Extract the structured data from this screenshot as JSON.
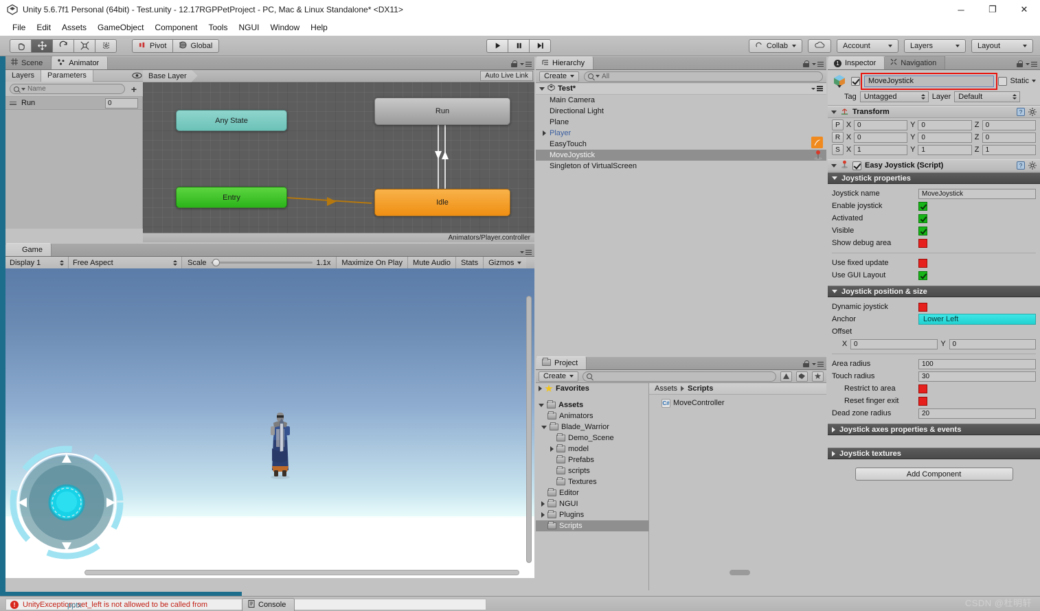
{
  "window": {
    "title": "Unity 5.6.7f1 Personal (64bit) - Test.unity - 12.17RGPPetProject - PC, Mac & Linux Standalone* <DX11>",
    "minimize": "─",
    "maximize": "❐",
    "close": "✕"
  },
  "menubar": {
    "items": [
      "File",
      "Edit",
      "Assets",
      "GameObject",
      "Component",
      "Tools",
      "NGUI",
      "Window",
      "Help"
    ]
  },
  "toolbar": {
    "tools": [
      "hand-tool",
      "move-tool",
      "rotate-tool",
      "scale-tool",
      "rect-tool"
    ],
    "active_tool_index": 1,
    "pivot_label": "Pivot",
    "global_label": "Global",
    "play_label": "Play",
    "pause_label": "Pause",
    "step_label": "Step",
    "collab_label": "Collab",
    "cloud_label": "Cloud",
    "account_label": "Account",
    "layers_label": "Layers",
    "layout_label": "Layout"
  },
  "animator": {
    "tabs": [
      {
        "label": "Scene",
        "icon": "grid-icon",
        "active": false
      },
      {
        "label": "Animator",
        "icon": "animator-icon",
        "active": true
      }
    ],
    "subtabs": [
      {
        "label": "Layers",
        "active": false
      },
      {
        "label": "Parameters",
        "active": true
      }
    ],
    "search_placeholder": "Name",
    "add_label": "+",
    "parameters": [
      {
        "name": "Run",
        "value": "0"
      }
    ],
    "layer_breadcrumb": "Base Layer",
    "auto_live_link": "Auto Live Link",
    "controller_path": "Animators/Player.controller",
    "states": [
      {
        "name": "Any State",
        "type": "any"
      },
      {
        "name": "Entry",
        "type": "entry"
      },
      {
        "name": "Run",
        "type": "state"
      },
      {
        "name": "Idle",
        "type": "default"
      }
    ]
  },
  "game": {
    "tab_label": "Game",
    "display": "Display 1",
    "aspect": "Free Aspect",
    "scale_label": "Scale",
    "scale_value": "1.1x",
    "maximize_on_play": "Maximize On Play",
    "mute_audio": "Mute Audio",
    "stats": "Stats",
    "gizmos": "Gizmos"
  },
  "hierarchy": {
    "tab_label": "Hierarchy",
    "create_label": "Create",
    "search_placeholder": "All",
    "scene_name": "Test*",
    "items": [
      {
        "label": "Main Camera",
        "expandable": false,
        "selected": false,
        "child_ref": false
      },
      {
        "label": "Directional Light",
        "expandable": false,
        "selected": false,
        "child_ref": false
      },
      {
        "label": "Plane",
        "expandable": false,
        "selected": false,
        "child_ref": false
      },
      {
        "label": "Player",
        "expandable": true,
        "selected": false,
        "child_ref": true
      },
      {
        "label": "EasyTouch",
        "expandable": false,
        "selected": false,
        "child_ref": false
      },
      {
        "label": "MoveJoystick",
        "expandable": false,
        "selected": true,
        "child_ref": false
      },
      {
        "label": "Singleton of VirtualScreen",
        "expandable": false,
        "selected": false,
        "child_ref": false
      }
    ]
  },
  "project": {
    "tab_label": "Project",
    "create_label": "Create",
    "search_placeholder": "",
    "favorites_label": "Favorites",
    "tree": [
      {
        "label": "Assets",
        "depth": 0,
        "expanded": true,
        "bold": true,
        "selected": false
      },
      {
        "label": "Animators",
        "depth": 1,
        "expanded": null,
        "bold": false,
        "selected": false
      },
      {
        "label": "Blade_Warrior",
        "depth": 1,
        "expanded": true,
        "bold": false,
        "selected": false
      },
      {
        "label": "Demo_Scene",
        "depth": 2,
        "expanded": null,
        "bold": false,
        "selected": false
      },
      {
        "label": "model",
        "depth": 2,
        "expanded": false,
        "bold": false,
        "selected": false
      },
      {
        "label": "Prefabs",
        "depth": 2,
        "expanded": null,
        "bold": false,
        "selected": false
      },
      {
        "label": "scripts",
        "depth": 2,
        "expanded": null,
        "bold": false,
        "selected": false
      },
      {
        "label": "Textures",
        "depth": 2,
        "expanded": null,
        "bold": false,
        "selected": false
      },
      {
        "label": "Editor",
        "depth": 1,
        "expanded": null,
        "bold": false,
        "selected": false
      },
      {
        "label": "NGUI",
        "depth": 1,
        "expanded": false,
        "bold": false,
        "selected": false
      },
      {
        "label": "Plugins",
        "depth": 1,
        "expanded": false,
        "bold": false,
        "selected": false
      },
      {
        "label": "Scripts",
        "depth": 1,
        "expanded": null,
        "bold": false,
        "selected": true
      }
    ],
    "breadcrumb": [
      "Assets",
      "Scripts"
    ],
    "files": [
      {
        "label": "MoveController",
        "icon": "csharp-script-icon"
      }
    ]
  },
  "inspector": {
    "tabs": [
      {
        "label": "Inspector",
        "active": true
      },
      {
        "label": "Navigation",
        "active": false
      }
    ],
    "badge": "1",
    "gameobject": {
      "name": "MoveJoystick",
      "enabled": true,
      "static_label": "Static",
      "static_checked": false,
      "tag_label": "Tag",
      "tag_value": "Untagged",
      "layer_label": "Layer",
      "layer_value": "Default"
    },
    "transform": {
      "title": "Transform",
      "rows": [
        {
          "key": "P",
          "x": "0",
          "y": "0",
          "z": "0"
        },
        {
          "key": "R",
          "x": "0",
          "y": "0",
          "z": "0"
        },
        {
          "key": "S",
          "x": "1",
          "y": "1",
          "z": "1"
        }
      ]
    },
    "script": {
      "title": "Easy Joystick (Script)",
      "enabled": true
    },
    "joystick_properties": {
      "header": "Joystick properties",
      "expanded": true,
      "rows": [
        {
          "label": "Joystick name",
          "type": "text",
          "value": "MoveJoystick"
        },
        {
          "label": "Enable joystick",
          "type": "toggle",
          "on": true
        },
        {
          "label": "Activated",
          "type": "toggle",
          "on": true
        },
        {
          "label": "Visible",
          "type": "toggle",
          "on": true
        },
        {
          "label": "Show debug area",
          "type": "toggle",
          "on": false
        }
      ],
      "rows2": [
        {
          "label": "Use fixed update",
          "type": "toggle",
          "on": false
        },
        {
          "label": "Use GUI Layout",
          "type": "toggle",
          "on": true
        }
      ]
    },
    "joystick_position": {
      "header": "Joystick position & size",
      "expanded": true,
      "dynamic_label": "Dynamic joystick",
      "dynamic_on": false,
      "anchor_label": "Anchor",
      "anchor_value": "Lower Left",
      "offset_label": "Offset",
      "offset_x": "0",
      "offset_y": "0",
      "rows": [
        {
          "label": "Area radius",
          "type": "text",
          "value": "100",
          "indent": false
        },
        {
          "label": "Touch radius",
          "type": "text",
          "value": "30",
          "indent": false
        },
        {
          "label": "Restrict to area",
          "type": "toggle",
          "on": false,
          "indent": true
        },
        {
          "label": "Reset  finger exit",
          "type": "toggle",
          "on": false,
          "indent": true
        },
        {
          "label": "Dead zone radius",
          "type": "text",
          "value": "20",
          "indent": false
        }
      ]
    },
    "joystick_axes": {
      "header": "Joystick axes properties & events",
      "expanded": false
    },
    "joystick_textures": {
      "header": "Joystick textures",
      "expanded": false
    },
    "add_component": "Add Component"
  },
  "statusbar": {
    "error_message": "UnityException: set_left is not allowed to be called from",
    "console_label": "Console",
    "watermark": "CSDN @杜明轩",
    "ghost_text": "pptx"
  },
  "colors": {
    "accent_blue": "#1c6e8c",
    "error_red": "#c21f14",
    "toggle_green": "#17b517",
    "toggle_red": "#e6201c",
    "anchor_cyan": "#2fd9d9",
    "state_idle": "#ef8f12",
    "state_entry": "#2bb41a",
    "state_any": "#6cc2b8",
    "highlight_box": "#e8150f"
  }
}
